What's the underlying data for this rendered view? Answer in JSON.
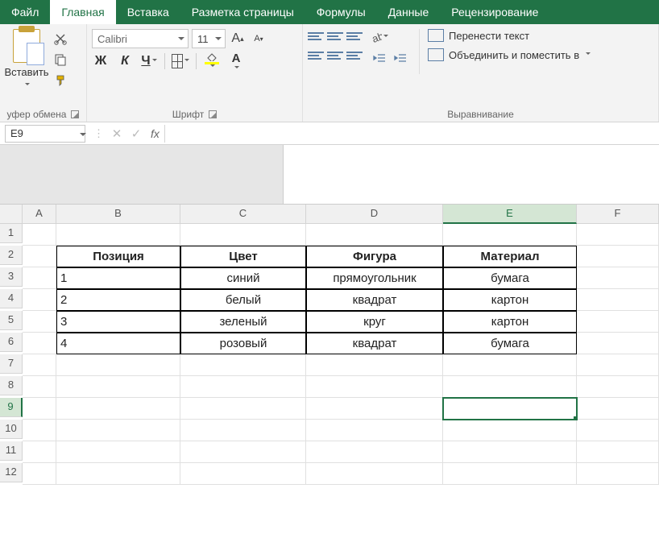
{
  "tabs": {
    "file": "Файл",
    "home": "Главная",
    "insert": "Вставка",
    "layout": "Разметка страницы",
    "formulas": "Формулы",
    "data": "Данные",
    "review": "Рецензирование"
  },
  "ribbon": {
    "clipboard": {
      "paste": "Вставить",
      "label": "уфер обмена"
    },
    "font": {
      "name": "Calibri",
      "size": "11",
      "bold": "Ж",
      "italic": "К",
      "underline": "Ч",
      "label": "Шрифт"
    },
    "alignment": {
      "wrap": "Перенести текст",
      "merge": "Объединить и поместить в ",
      "label": "Выравнивание"
    }
  },
  "namebox": "E9",
  "columns": [
    "A",
    "B",
    "C",
    "D",
    "E",
    "F"
  ],
  "rows": [
    "1",
    "2",
    "3",
    "4",
    "5",
    "6",
    "7",
    "8",
    "9",
    "10",
    "11",
    "12"
  ],
  "selected": {
    "col": "E",
    "row": "9"
  },
  "table": {
    "headers": [
      "Позиция",
      "Цвет",
      "Фигура",
      "Материал"
    ],
    "rows": [
      [
        "1",
        "синий",
        "прямоугольник",
        "бумага"
      ],
      [
        "2",
        "белый",
        "квадрат",
        "картон"
      ],
      [
        "3",
        "зеленый",
        "круг",
        "картон"
      ],
      [
        "4",
        "розовый",
        "квадрат",
        "бумага"
      ]
    ]
  }
}
